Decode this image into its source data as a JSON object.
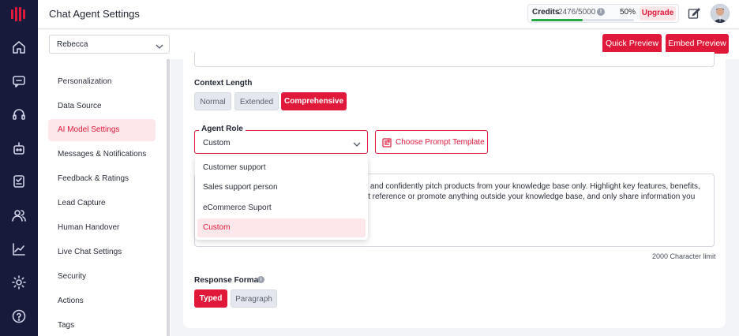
{
  "header": {
    "title": "Chat Agent Settings",
    "credits_label": "Credits",
    "credits_count": "2476/5000",
    "credits_percent_label": "50%",
    "credits_fraction": 0.5,
    "upgrade_label": "Upgrade"
  },
  "toolbar": {
    "agent_name": "Rebecca",
    "quick_preview_label": "Quick Preview",
    "embed_preview_label": "Embed Preview"
  },
  "menu": {
    "items": [
      "Personalization",
      "Data Source",
      "AI Model Settings",
      "Messages & Notifications",
      "Feedback & Ratings",
      "Lead Capture",
      "Human Handover",
      "Live Chat Settings",
      "Security",
      "Actions",
      "Tags"
    ],
    "active_index": 2
  },
  "context_length": {
    "label": "Context Length",
    "options": [
      "Normal",
      "Extended",
      "Comprehensive"
    ],
    "selected": "Comprehensive"
  },
  "agent_role": {
    "label": "Agent Role",
    "value": "Custom",
    "options": [
      "Customer support",
      "Sales support person",
      "eCommerce Suport",
      "Custom"
    ],
    "selected": "Custom"
  },
  "template_button_label": "Choose Prompt Template",
  "prompt": {
    "lines": [
      "on and confidently pitch products from your knowledge base only. Highlight key features, benefits,",
      "not reference or promote anything outside your knowledge base, and only share information you"
    ],
    "char_limit": "2000 Character limit"
  },
  "response_format": {
    "label": "Response Format",
    "options": [
      "Typed",
      "Paragraph"
    ],
    "selected": "Typed"
  },
  "colors": {
    "accent": "#e0193a",
    "rail": "#171a3a",
    "progress": "#28a745"
  },
  "icons": {
    "rail": [
      "logo-icon",
      "home-icon",
      "chat-icon",
      "headset-icon",
      "bot-icon",
      "checklist-icon",
      "users-icon",
      "analytics-icon",
      "settings-icon",
      "help-icon"
    ],
    "header": [
      "info-icon",
      "edit-icon",
      "avatar"
    ]
  }
}
